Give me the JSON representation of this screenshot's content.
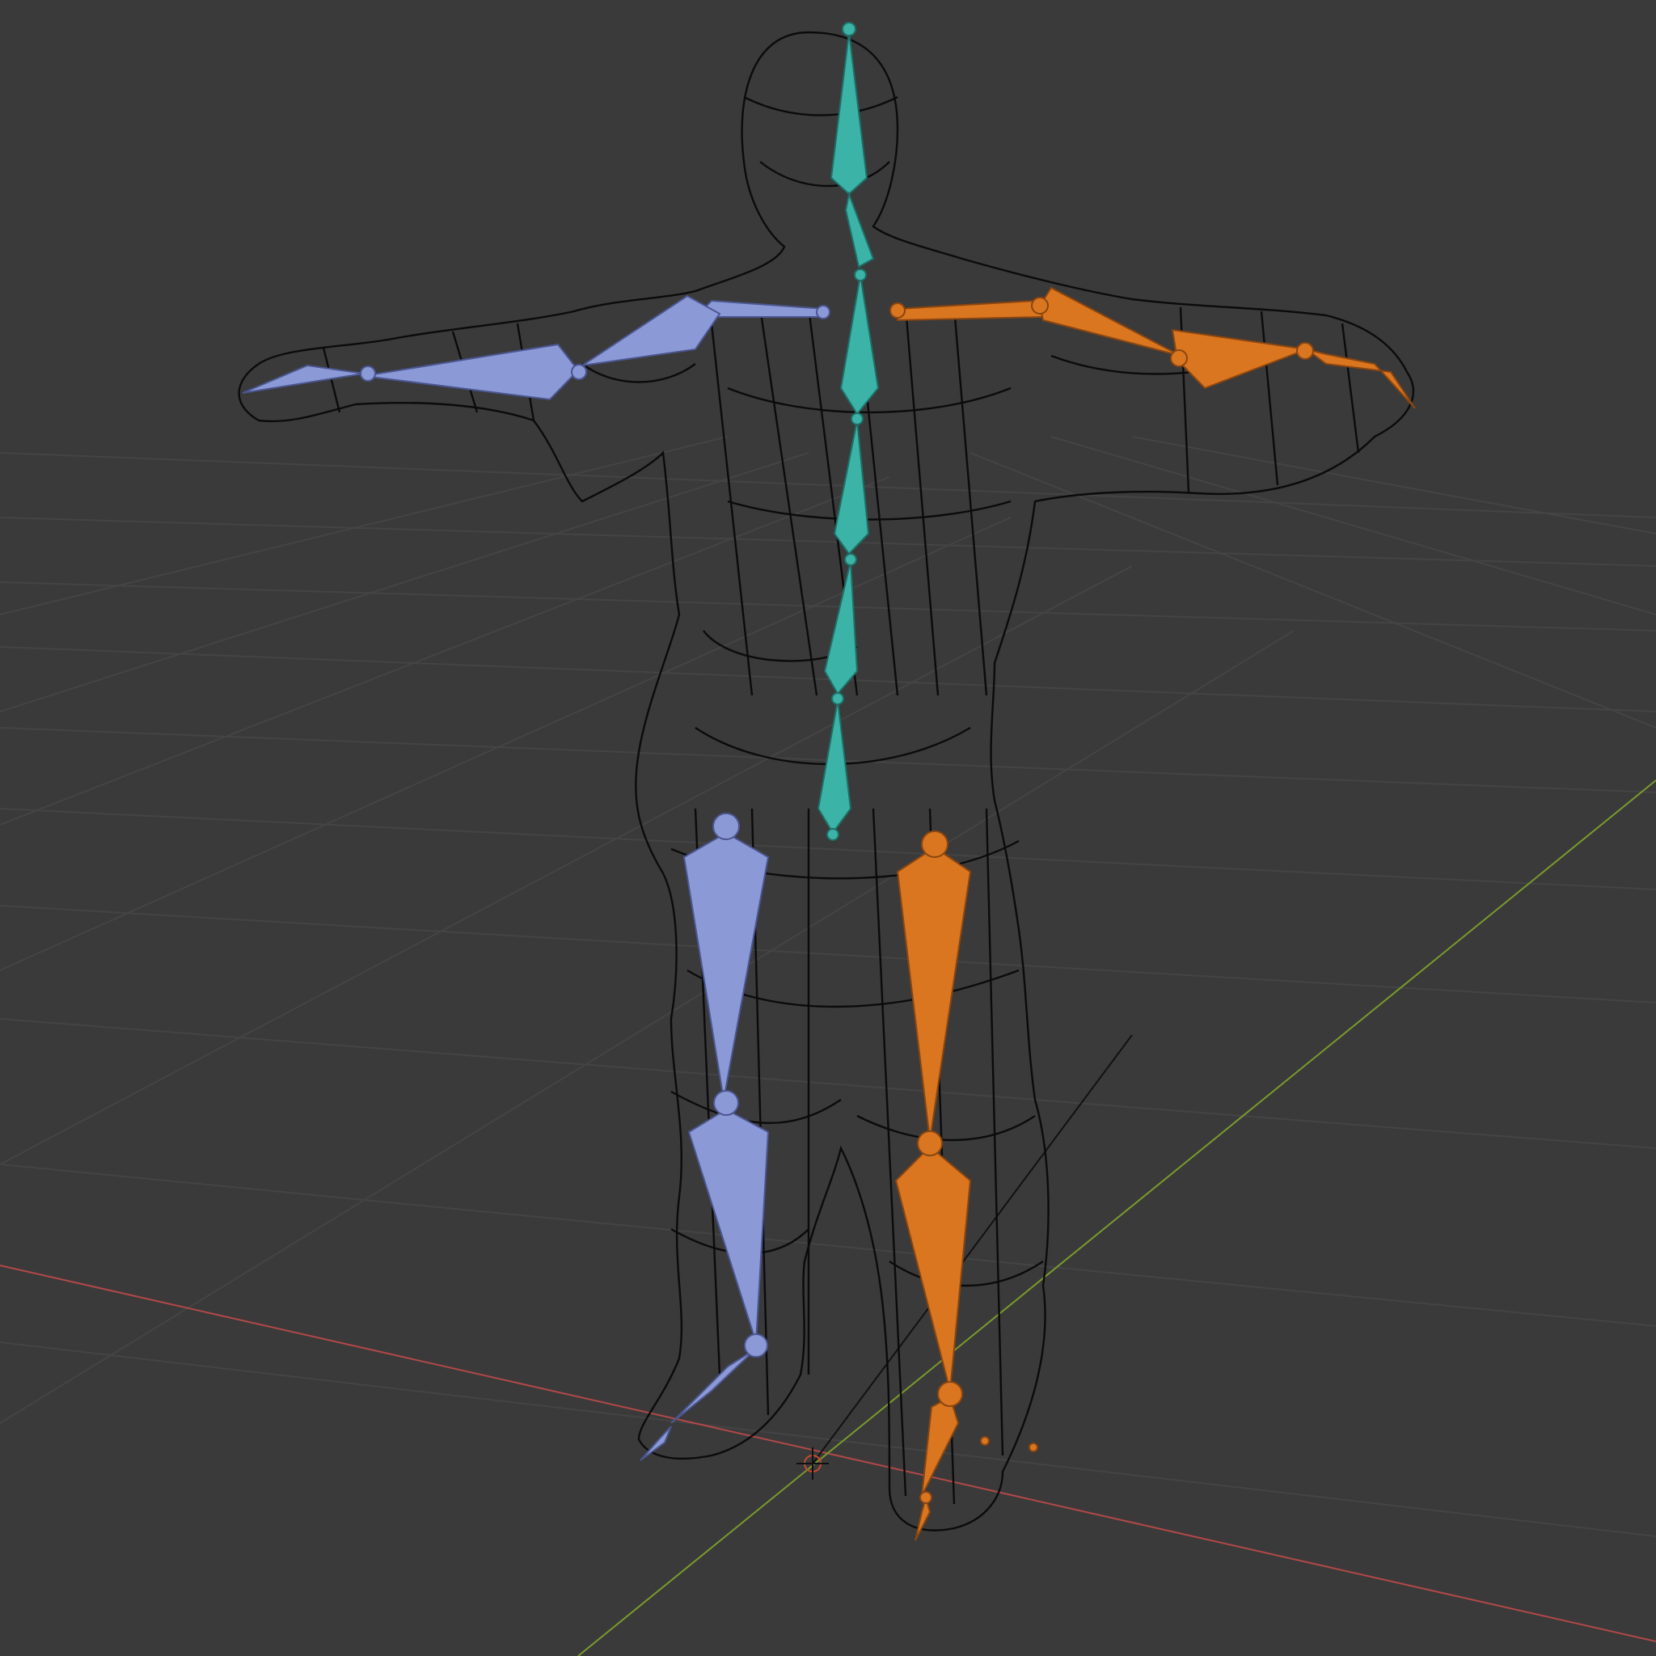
{
  "viewport": {
    "background": "#3a3a3a",
    "grid_color": "#444444",
    "x_axis_color": "#b24848",
    "y_axis_color": "#7a9a2c",
    "mesh_color": "#0b0b0b",
    "mode": "wireframe"
  },
  "armature": {
    "center_color": "#3bb3a6",
    "left_color": "#8b9ad6",
    "right_color": "#d9761f",
    "bones_center": [
      "head",
      "neck",
      "spine-upper",
      "spine-mid",
      "spine-lower",
      "pelvis"
    ],
    "bones_left": [
      "shoulder-l",
      "upper-arm-l",
      "forearm-l",
      "hand-l",
      "thigh-l",
      "shin-l",
      "foot-l",
      "toe-l"
    ],
    "bones_right": [
      "shoulder-r",
      "upper-arm-r",
      "forearm-r",
      "hand-r",
      "thigh-r",
      "shin-r",
      "foot-r",
      "toe-r"
    ]
  },
  "icons": {
    "origin": "3d-cursor-icon"
  }
}
